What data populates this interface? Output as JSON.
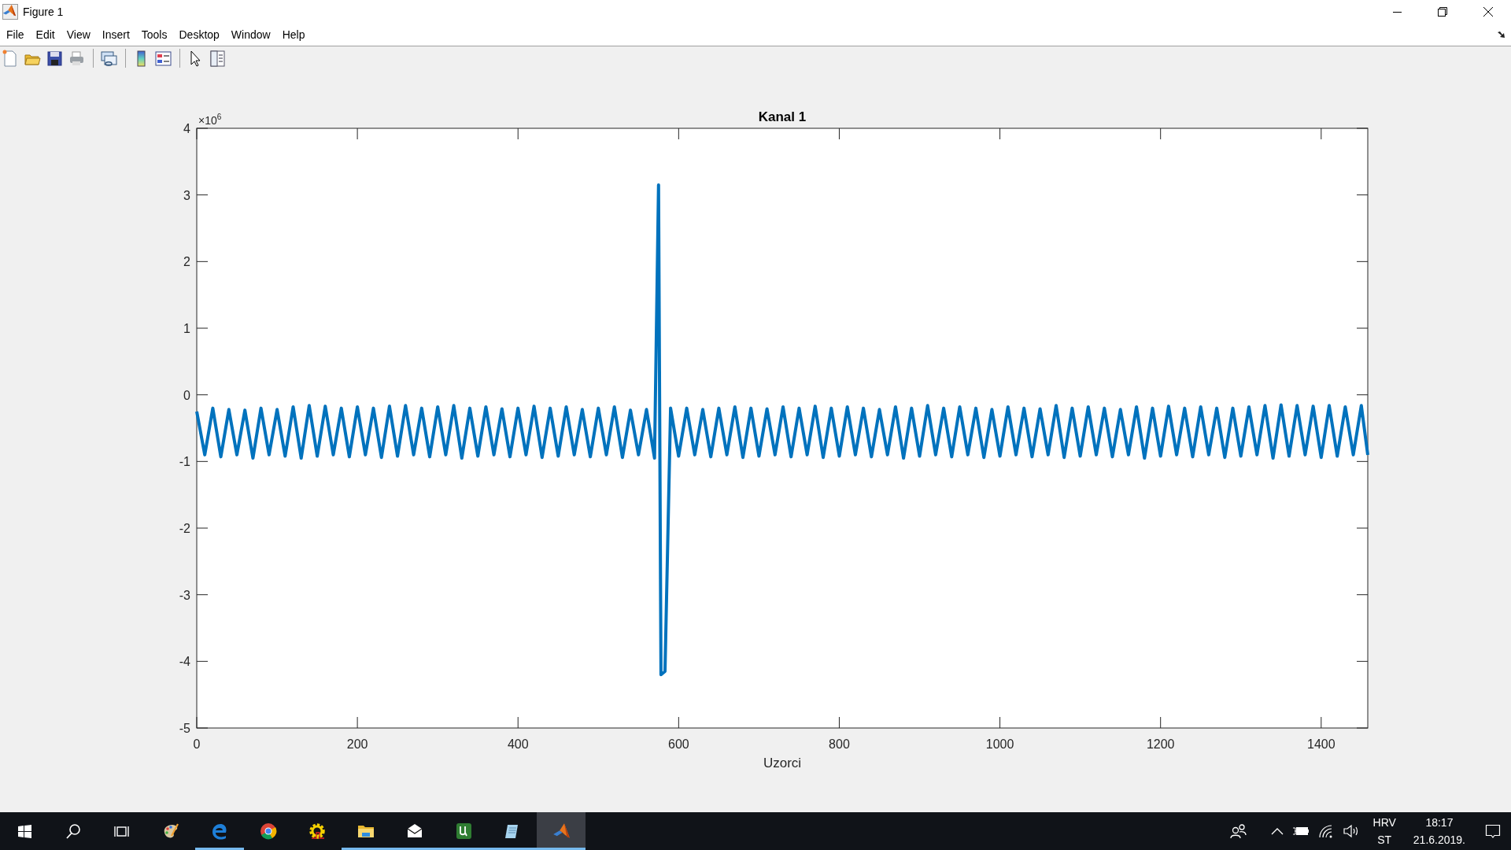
{
  "window": {
    "title": "Figure 1"
  },
  "menu": [
    "File",
    "Edit",
    "View",
    "Insert",
    "Tools",
    "Desktop",
    "Window",
    "Help"
  ],
  "figure": {
    "chart_data": {
      "type": "line",
      "title": "Kanal 1",
      "xlabel": "Uzorci",
      "xlim": [
        0,
        1458
      ],
      "ylim": [
        -5,
        4
      ],
      "xticks": [
        0,
        200,
        400,
        600,
        800,
        1000,
        1200,
        1400
      ],
      "yticks": [
        -5,
        -4,
        -3,
        -2,
        -1,
        0,
        1,
        2,
        3,
        4
      ],
      "annotations": [
        {
          "text": "×10$^{6}$"
        }
      ],
      "x": [
        0,
        10,
        20,
        30,
        40,
        50,
        60,
        70,
        80,
        90,
        100,
        110,
        120,
        130,
        140,
        150,
        160,
        170,
        180,
        190,
        200,
        210,
        220,
        230,
        240,
        250,
        260,
        270,
        280,
        290,
        300,
        310,
        320,
        330,
        340,
        350,
        360,
        370,
        380,
        390,
        400,
        410,
        420,
        430,
        440,
        450,
        460,
        470,
        480,
        490,
        500,
        510,
        520,
        530,
        540,
        550,
        560,
        570,
        575,
        578,
        583,
        590,
        600,
        610,
        620,
        630,
        640,
        650,
        660,
        670,
        680,
        690,
        700,
        710,
        720,
        730,
        740,
        750,
        760,
        770,
        780,
        790,
        800,
        810,
        820,
        830,
        840,
        850,
        860,
        870,
        880,
        890,
        900,
        910,
        920,
        930,
        940,
        950,
        960,
        970,
        980,
        990,
        1000,
        1010,
        1020,
        1030,
        1040,
        1050,
        1060,
        1070,
        1080,
        1090,
        1100,
        1110,
        1120,
        1130,
        1140,
        1150,
        1160,
        1170,
        1180,
        1190,
        1200,
        1210,
        1220,
        1230,
        1240,
        1250,
        1260,
        1270,
        1280,
        1290,
        1300,
        1310,
        1320,
        1330,
        1340,
        1350,
        1360,
        1370,
        1380,
        1390,
        1400,
        1410,
        1420,
        1430,
        1440,
        1450,
        1458
      ],
      "series": [
        {
          "color": "#0072bd",
          "values": [
            -0.25,
            -0.9,
            -0.2,
            -0.93,
            -0.22,
            -0.9,
            -0.23,
            -0.95,
            -0.2,
            -0.9,
            -0.22,
            -0.92,
            -0.18,
            -0.95,
            -0.16,
            -0.92,
            -0.17,
            -0.9,
            -0.2,
            -0.93,
            -0.18,
            -0.9,
            -0.2,
            -0.94,
            -0.17,
            -0.92,
            -0.16,
            -0.9,
            -0.2,
            -0.93,
            -0.18,
            -0.9,
            -0.16,
            -0.95,
            -0.2,
            -0.92,
            -0.18,
            -0.9,
            -0.21,
            -0.93,
            -0.2,
            -0.9,
            -0.17,
            -0.94,
            -0.2,
            -0.92,
            -0.18,
            -0.9,
            -0.22,
            -0.93,
            -0.2,
            -0.9,
            -0.18,
            -0.94,
            -0.23,
            -0.9,
            -0.22,
            -0.95,
            3.15,
            -4.2,
            -4.15,
            -0.2,
            -0.92,
            -0.2,
            -0.9,
            -0.22,
            -0.93,
            -0.2,
            -0.9,
            -0.18,
            -0.94,
            -0.2,
            -0.92,
            -0.21,
            -0.9,
            -0.18,
            -0.93,
            -0.2,
            -0.9,
            -0.17,
            -0.94,
            -0.2,
            -0.92,
            -0.18,
            -0.9,
            -0.2,
            -0.93,
            -0.22,
            -0.9,
            -0.18,
            -0.95,
            -0.2,
            -0.92,
            -0.16,
            -0.9,
            -0.2,
            -0.93,
            -0.18,
            -0.9,
            -0.2,
            -0.94,
            -0.22,
            -0.92,
            -0.18,
            -0.9,
            -0.2,
            -0.93,
            -0.21,
            -0.9,
            -0.16,
            -0.94,
            -0.2,
            -0.92,
            -0.18,
            -0.9,
            -0.2,
            -0.93,
            -0.22,
            -0.9,
            -0.18,
            -0.95,
            -0.2,
            -0.92,
            -0.17,
            -0.9,
            -0.2,
            -0.93,
            -0.18,
            -0.9,
            -0.2,
            -0.94,
            -0.2,
            -0.92,
            -0.18,
            -0.9,
            -0.16,
            -0.95,
            -0.15,
            -0.92,
            -0.16,
            -0.9,
            -0.17,
            -0.94,
            -0.16,
            -0.92,
            -0.18,
            -0.9,
            -0.16,
            -0.9
          ]
        }
      ]
    }
  },
  "taskbar": {
    "apps": [
      {
        "kind": "start",
        "running": false,
        "active": false
      },
      {
        "kind": "search",
        "running": false,
        "active": false
      },
      {
        "kind": "task-view",
        "running": false,
        "active": false
      },
      {
        "kind": "paint",
        "running": false,
        "active": false
      },
      {
        "kind": "edge",
        "running": true,
        "active": false
      },
      {
        "kind": "chrome",
        "running": false,
        "active": false
      },
      {
        "kind": "gear",
        "running": false,
        "active": false
      },
      {
        "kind": "folder",
        "running": true,
        "active": false
      },
      {
        "kind": "mail",
        "running": true,
        "active": false
      },
      {
        "kind": "torrent",
        "running": true,
        "active": false
      },
      {
        "kind": "notepad",
        "running": true,
        "active": false
      },
      {
        "kind": "matlab",
        "running": true,
        "active": true
      }
    ],
    "tray": {
      "language": "HRV",
      "layout": "ST",
      "time": "18:17",
      "date": "21.6.2019."
    }
  }
}
